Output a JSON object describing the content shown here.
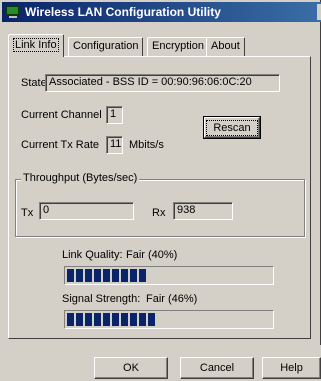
{
  "window": {
    "title": "Wireless LAN Configuration Utility",
    "icon": "monitor-icon"
  },
  "tabs": [
    {
      "label": "Link Info",
      "active": true
    },
    {
      "label": "Configuration",
      "active": false
    },
    {
      "label": "Encryption",
      "active": false
    },
    {
      "label": "About",
      "active": false
    }
  ],
  "link_info": {
    "state_label": "State",
    "state_value": "Associated - BSS ID = 00:90:96:06:0C:20",
    "channel_label": "Current Channel",
    "channel_value": "1",
    "txrate_label": "Current Tx Rate",
    "txrate_value": "11",
    "txrate_unit": "Mbits/s",
    "rescan_label": "Rescan"
  },
  "throughput": {
    "title": "Throughput (Bytes/sec)",
    "tx_label": "Tx",
    "tx_value": "0",
    "rx_label": "Rx",
    "rx_value": "938"
  },
  "link_quality": {
    "label": "Link Quality:",
    "value_text": "Fair (40%)",
    "percent": 40
  },
  "signal_strength": {
    "label": "Signal Strength:",
    "value_text": "Fair (46%)",
    "percent": 46
  },
  "buttons": {
    "ok": "OK",
    "cancel": "Cancel",
    "help": "Help"
  },
  "colors": {
    "title_bar": "#0a246a",
    "progress_fill": "#0a246a",
    "face": "#d4d0c8"
  }
}
